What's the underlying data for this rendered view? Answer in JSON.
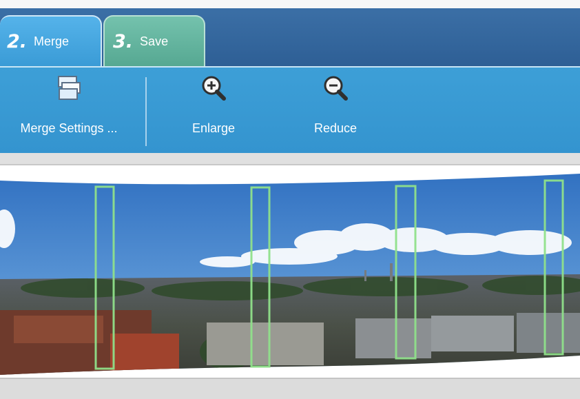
{
  "tabs": [
    {
      "number": "2.",
      "label": "Merge",
      "active": true
    },
    {
      "number": "3.",
      "label": "Save",
      "active": false
    }
  ],
  "toolbar": {
    "merge_settings": "Merge Settings ...",
    "enlarge": "Enlarge",
    "reduce": "Reduce"
  },
  "icons": {
    "merge_settings": "stacked-photos-icon",
    "enlarge": "zoom-in-icon",
    "reduce": "zoom-out-icon"
  },
  "colors": {
    "tabbar": "#2e5f95",
    "merge_tab": "#3a9bd6",
    "save_tab": "#56a892",
    "toolbar": "#3494cf",
    "seam_marker": "#8fe08a"
  },
  "panorama": {
    "seam_marker_count": 4
  }
}
